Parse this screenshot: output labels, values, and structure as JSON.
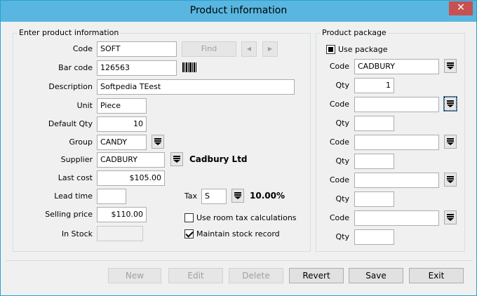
{
  "window": {
    "title": "Product information",
    "close_glyph": "✕"
  },
  "left_group": {
    "legend": "Enter product information",
    "code": {
      "label": "Code",
      "value": "SOFT"
    },
    "find_button": "Find",
    "prev_glyph": "◀",
    "next_glyph": "▶",
    "barcode": {
      "label": "Bar code",
      "value": "126563"
    },
    "description": {
      "label": "Description",
      "value": "Softpedia TEest"
    },
    "unit": {
      "label": "Unit",
      "value": "Piece"
    },
    "default_qty": {
      "label": "Default Qty",
      "value": "10"
    },
    "group": {
      "label": "Group",
      "value": "CANDY"
    },
    "supplier": {
      "label": "Supplier",
      "value": "CADBURY",
      "name": "Cadbury Ltd"
    },
    "last_cost": {
      "label": "Last cost",
      "value": "$105.00"
    },
    "lead_time": {
      "label": "Lead time",
      "value": ""
    },
    "tax": {
      "label": "Tax",
      "value": "S",
      "rate": "10.00%"
    },
    "selling_price": {
      "label": "Selling price",
      "value": "$110.00"
    },
    "in_stock": {
      "label": "In Stock",
      "value": ""
    },
    "use_room_tax": {
      "label": "Use room tax calculations",
      "checked": false
    },
    "maintain_stock": {
      "label": "Maintain stock record",
      "checked": true
    }
  },
  "right_group": {
    "legend": "Product package",
    "use_package": {
      "label": "Use package",
      "checked": true
    },
    "rows": [
      {
        "code_label": "Code",
        "code": "CADBURY",
        "qty_label": "Qty",
        "qty": "1"
      },
      {
        "code_label": "Code",
        "code": "",
        "qty_label": "Qty",
        "qty": ""
      },
      {
        "code_label": "Code",
        "code": "",
        "qty_label": "Qty",
        "qty": ""
      },
      {
        "code_label": "Code",
        "code": "",
        "qty_label": "Qty",
        "qty": ""
      },
      {
        "code_label": "Code",
        "code": "",
        "qty_label": "Qty",
        "qty": ""
      }
    ]
  },
  "buttons": {
    "new": "New",
    "edit": "Edit",
    "delete": "Delete",
    "revert": "Revert",
    "save": "Save",
    "exit": "Exit"
  }
}
